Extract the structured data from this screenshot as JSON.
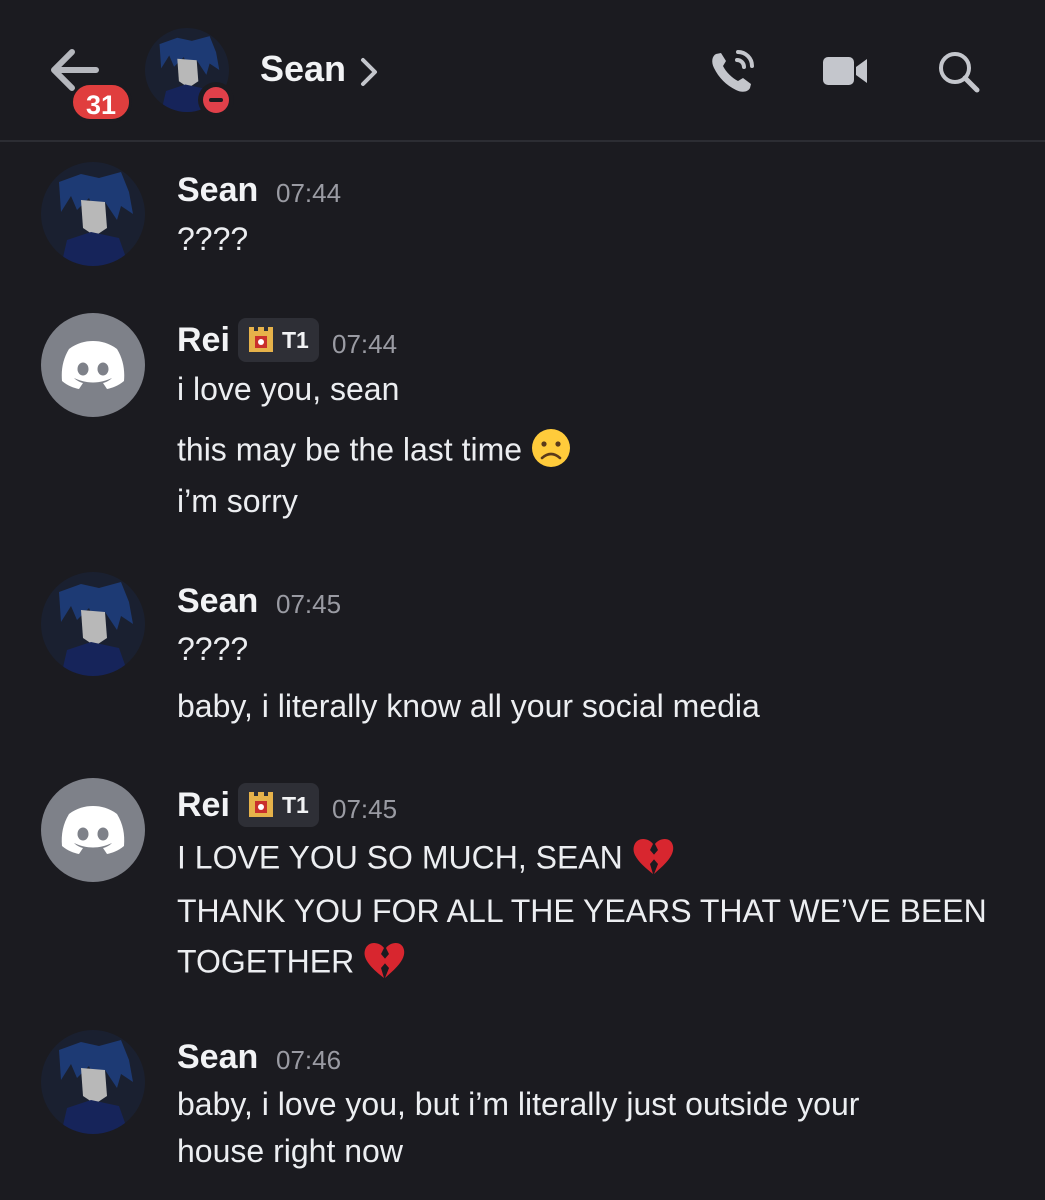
{
  "header": {
    "unread_count": "31",
    "contact_name": "Sean",
    "icons": [
      "back-arrow-icon",
      "chevron-right-icon",
      "phone-call-icon",
      "video-camera-icon",
      "search-icon"
    ]
  },
  "messages": [
    {
      "author": "Sean",
      "time": "07:44",
      "lines": [
        "????"
      ]
    },
    {
      "author": "Rei",
      "tag": "T1",
      "time": "07:44",
      "lines": [
        "i love you, sean",
        "this may be the last time",
        "i’m sorry"
      ]
    },
    {
      "author": "Sean",
      "time": "07:45",
      "lines": [
        "????",
        "baby, i literally know all your social media"
      ]
    },
    {
      "author": "Rei",
      "tag": "T1",
      "time": "07:45",
      "lines": [
        "I LOVE YOU SO MUCH, SEAN",
        "THANK YOU FOR ALL THE YEARS THAT WE’VE BEEN",
        "TOGETHER"
      ]
    },
    {
      "author": "Sean",
      "time": "07:46",
      "lines": [
        "baby, i love you, but i’m literally just outside your",
        "house right now"
      ]
    }
  ],
  "colors": {
    "background": "#1b1b20",
    "badge": "#e03e3e",
    "dnd": "#e0404a",
    "discord_avatar": "#7e8189",
    "timestamp": "#9a9ba3"
  }
}
